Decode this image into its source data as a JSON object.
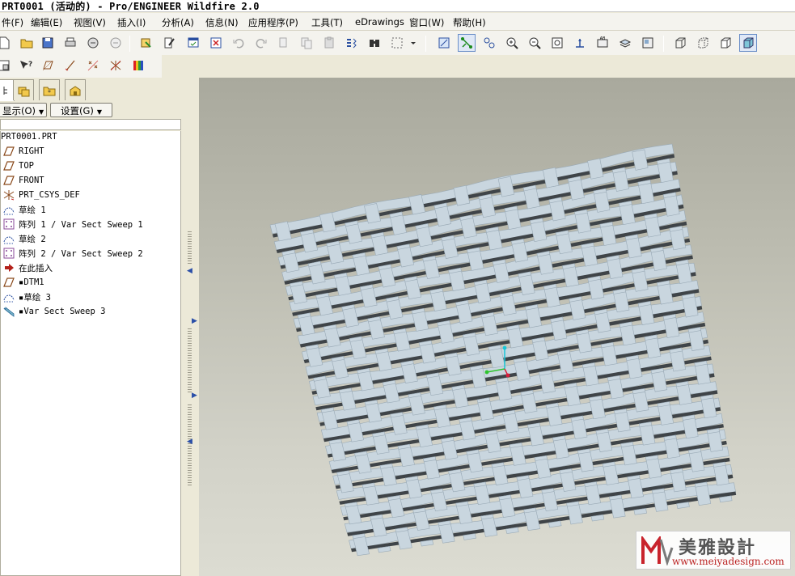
{
  "window": {
    "title": "PRT0001 (活动的) - Pro/ENGINEER Wildfire 2.0"
  },
  "menu": [
    {
      "label": "件(F)"
    },
    {
      "label": "编辑(E)"
    },
    {
      "label": "视图(V)"
    },
    {
      "label": "插入(I)"
    },
    {
      "label": "分析(A)"
    },
    {
      "label": "信息(N)"
    },
    {
      "label": "应用程序(P)"
    },
    {
      "label": "工具(T)"
    },
    {
      "label": "eDrawings"
    },
    {
      "label": "窗口(W)"
    },
    {
      "label": "帮助(H)"
    }
  ],
  "toolbar_icons": {
    "row1": [
      "new-icon",
      "open-icon",
      "save-icon",
      "print-icon",
      "send-icon",
      "send-mail-icon",
      "regenerate-icon",
      "edit-icon",
      "window-icon",
      "close-window-icon",
      "undo-icon",
      "redo-icon",
      "cut-icon",
      "copy-icon",
      "paste-icon",
      "paste-special-icon",
      "find-icon",
      "select-box-icon",
      "dropdown-icon",
      "datum-plane-icon",
      "datum-axis-icon",
      "datum-point-icon",
      "zoom-in-icon",
      "zoom-out-icon",
      "refit-icon",
      "reorient-icon",
      "saved-views-icon",
      "layers-icon",
      "view-manager-icon",
      "wireframe-icon",
      "hidden-line-icon",
      "no-hidden-icon",
      "shading-icon"
    ],
    "row2": [
      "model-info-icon",
      "whats-this-icon",
      "plane-display-icon",
      "axis-display-icon",
      "point-display-icon",
      "csys-display-icon",
      "color-appearance-icon"
    ]
  },
  "nav_tabs": [
    "model-tree-tab",
    "folder-browser-tab",
    "favorites-tab",
    "connections-tab"
  ],
  "model_tree": {
    "show_label": "显示(O)",
    "settings_label": "设置(G)",
    "items": [
      {
        "label": "PRT0001.PRT",
        "icon": "part-icon"
      },
      {
        "label": "RIGHT",
        "icon": "datum-plane-icon"
      },
      {
        "label": "TOP",
        "icon": "datum-plane-icon"
      },
      {
        "label": "FRONT",
        "icon": "datum-plane-icon"
      },
      {
        "label": "PRT_CSYS_DEF",
        "icon": "csys-icon"
      },
      {
        "label": "草绘 1",
        "icon": "sketch-icon"
      },
      {
        "label": "阵列 1 / Var Sect Sweep 1",
        "icon": "pattern-icon"
      },
      {
        "label": "草绘 2",
        "icon": "sketch-icon"
      },
      {
        "label": "阵列 2 / Var Sect Sweep 2",
        "icon": "pattern-icon"
      },
      {
        "label": "在此插入",
        "icon": "insert-here-icon"
      },
      {
        "label": "▪DTM1",
        "icon": "datum-plane-icon"
      },
      {
        "label": "▪草绘 3",
        "icon": "sketch-icon"
      },
      {
        "label": "▪Var Sect Sweep 3",
        "icon": "sweep-icon"
      }
    ]
  },
  "watermark": {
    "title": "美雅設計",
    "url": "www.meiyadesign.com"
  },
  "colors": {
    "mesh_face": "#c9d6df",
    "mesh_edge": "#9aaab6",
    "hole_shadow": "#3f4448",
    "tree_icon": "#8a4a1c"
  }
}
